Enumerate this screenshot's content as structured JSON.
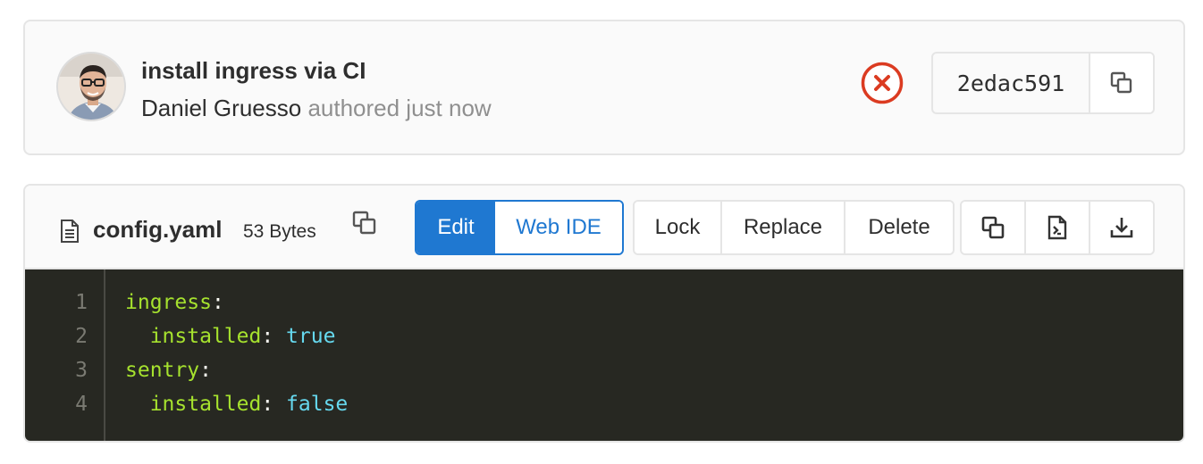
{
  "commit": {
    "title": "install ingress via CI",
    "author": "Daniel Gruesso",
    "authored_text": "authored just now",
    "pipeline_status": "failed",
    "sha": "2edac591",
    "status_color": "#db3b21"
  },
  "file": {
    "name": "config.yaml",
    "size": "53 Bytes",
    "buttons": {
      "edit": "Edit",
      "web_ide": "Web IDE",
      "lock": "Lock",
      "replace": "Replace",
      "delete": "Delete"
    },
    "icons": [
      "copy-source-icon",
      "open-raw-icon",
      "download-icon"
    ]
  },
  "code": {
    "line_numbers": [
      "1",
      "2",
      "3",
      "4"
    ],
    "lines": [
      {
        "indent": "",
        "key": "ingress",
        "sep": ":",
        "value": ""
      },
      {
        "indent": "  ",
        "key": "installed",
        "sep": ": ",
        "value": "true"
      },
      {
        "indent": "",
        "key": "sentry",
        "sep": ":",
        "value": ""
      },
      {
        "indent": "  ",
        "key": "installed",
        "sep": ": ",
        "value": "false"
      }
    ]
  },
  "colors": {
    "primary": "#1f78d1",
    "code_bg": "#272822",
    "code_key": "#a6e22e",
    "code_value": "#66d9ef"
  }
}
